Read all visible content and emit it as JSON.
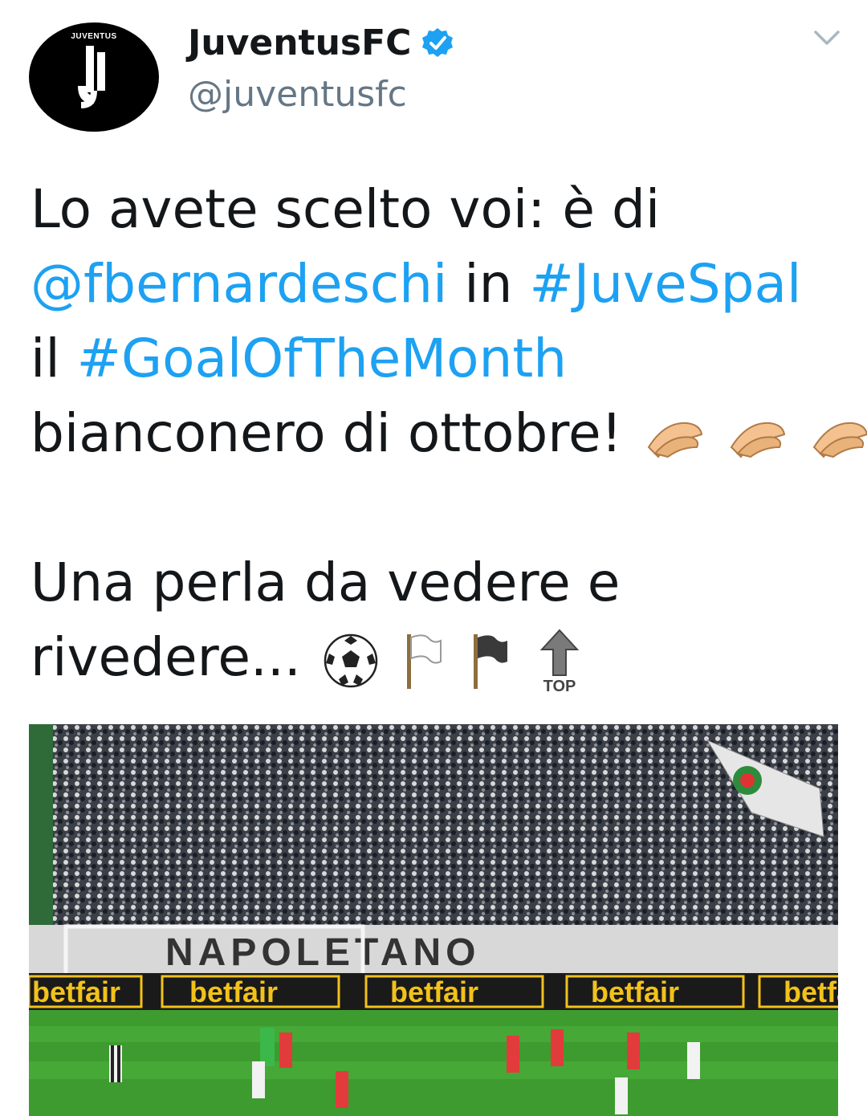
{
  "account": {
    "name": "JuventusFC",
    "handle": "@juventusfc",
    "avatar_text": "JUVENTUS",
    "verified": true
  },
  "tweet": {
    "line1": "Lo avete scelto voi: è di",
    "mention": "@fbernardeschi",
    "in_word": " in ",
    "hashtag1": "#JuveSpal",
    "il_word": "il ",
    "hashtag2": "#GoalOfTheMonth",
    "line4": "bianconero di ottobre!",
    "line5": "Una perla da vedere e",
    "line6": "rivedere...",
    "emojis_line4": [
      "clapping-hands-icon",
      "clapping-hands-icon",
      "clapping-hands-icon"
    ],
    "emojis_line6": [
      "soccer-ball-icon",
      "white-flag-icon",
      "black-flag-icon",
      "top-arrow-icon"
    ],
    "top_label": "TOP"
  },
  "media": {
    "sponsor": "betfair",
    "banner_text": "NAPOLETANO"
  },
  "colors": {
    "link": "#1da1f2",
    "text": "#14171a",
    "secondary": "#657786",
    "verified": "#1da1f2"
  }
}
